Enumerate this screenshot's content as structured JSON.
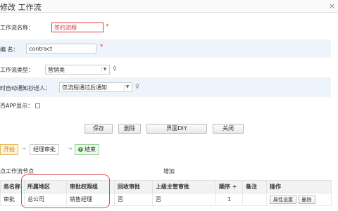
{
  "window": {
    "title": "修改 工作流",
    "close_glyph": "×"
  },
  "form": {
    "name_label": "工作流名称：",
    "name_value": "签约流程",
    "code_label": "编    名：",
    "code_value": "contract",
    "type_label": "工作流类型：",
    "type_value": "营销类",
    "notify_label": "时自动通知抄送人：",
    "notify_value": "仅流程通过后通知",
    "app_label": "否APP显示：",
    "required_mark": "*"
  },
  "buttons": {
    "save": "保存",
    "delete": "删除",
    "ui_diy": "界面DIY",
    "close": "关闭"
  },
  "flow": {
    "start": "开始",
    "mid": "经理审批",
    "end": "结束",
    "end_icon": "+"
  },
  "nodes_section": {
    "label": "点工作流节点",
    "add_link": "增加"
  },
  "table": {
    "headers": [
      "务名称",
      "所属地区",
      "审批权限组",
      "回收审批",
      "上级主管审批",
      "顺序",
      "备注",
      "操作"
    ],
    "sort_glyph": "÷",
    "rows": [
      {
        "name": "审批",
        "region": "总公司",
        "group": "销售经理",
        "recall": "否",
        "superior": "否",
        "order": "1",
        "note": "",
        "op_set": "属性设置",
        "op_delete": "删除"
      }
    ]
  }
}
